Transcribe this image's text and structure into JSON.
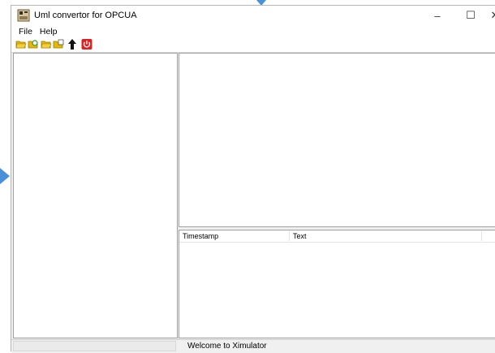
{
  "window": {
    "title": "Uml convertor for OPCUA",
    "controls": {
      "minimize": "–",
      "maximize": "☐",
      "close": "✕"
    }
  },
  "menu": {
    "items": [
      {
        "label": "File"
      },
      {
        "label": "Help"
      }
    ]
  },
  "toolbar": {
    "buttons": [
      {
        "icon": "open-folder-icon"
      },
      {
        "icon": "refresh-folder-icon"
      },
      {
        "icon": "save-folder-icon"
      },
      {
        "icon": "export-folder-icon"
      },
      {
        "icon": "upload-arrow-icon"
      },
      {
        "icon": "power-off-icon"
      }
    ]
  },
  "log": {
    "columns": [
      {
        "label": "Timestamp"
      },
      {
        "label": "Text"
      }
    ],
    "rows": []
  },
  "status": {
    "message": "Welcome to Ximulator"
  },
  "colors": {
    "accent_marker": "#4a90d9",
    "folder": "#e6b800",
    "power": "#e02020"
  }
}
